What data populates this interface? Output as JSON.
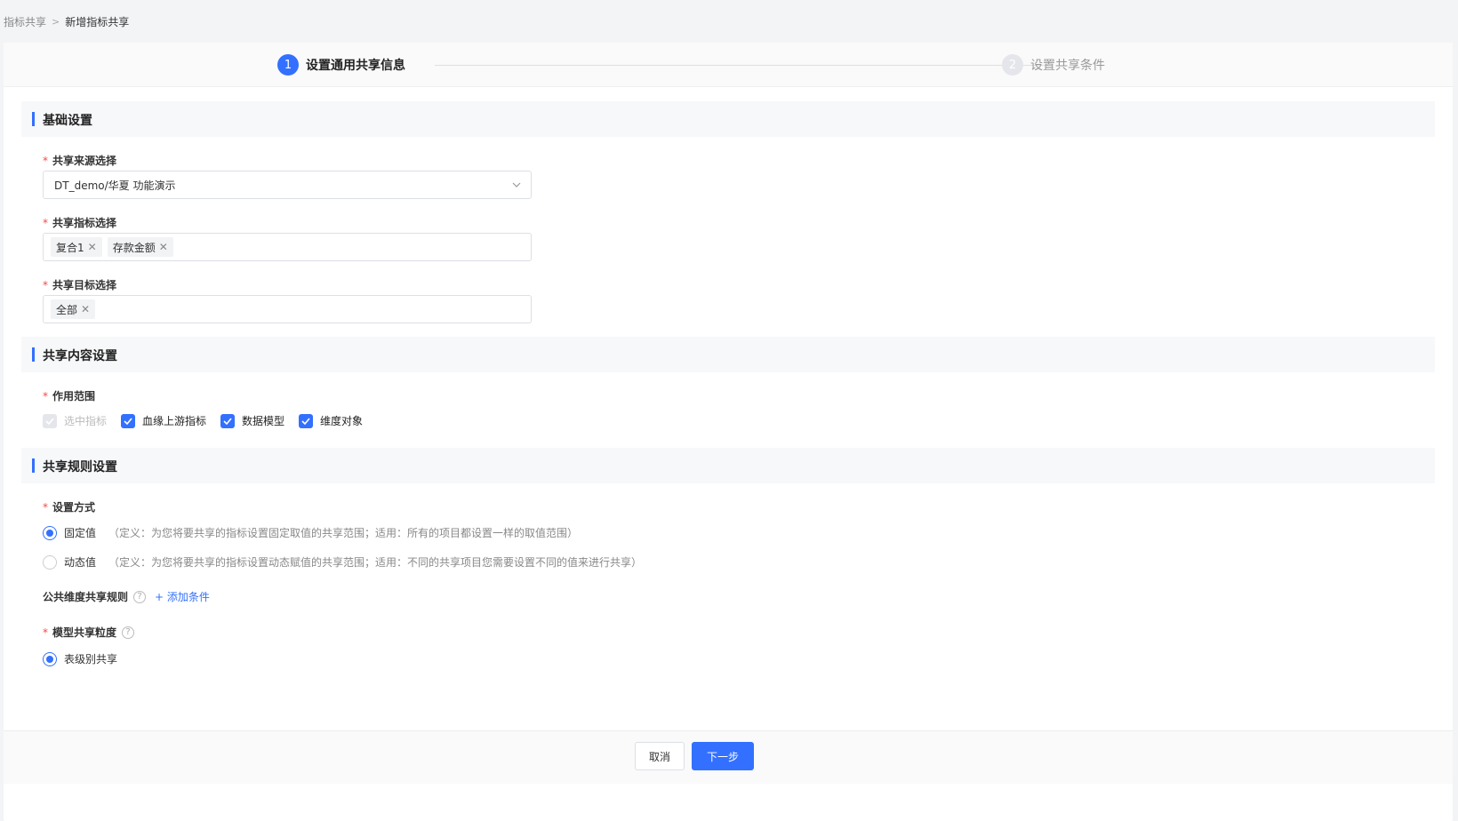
{
  "breadcrumb": {
    "parent": "指标共享",
    "separator": ">",
    "current": "新增指标共享"
  },
  "steps": [
    {
      "num": "1",
      "label": "设置通用共享信息"
    },
    {
      "num": "2",
      "label": "设置共享条件"
    }
  ],
  "sections": {
    "basic": "基础设置",
    "content": "共享内容设置",
    "rules": "共享规则设置"
  },
  "source": {
    "label": "共享来源选择",
    "value": "DT_demo/华夏 功能演示"
  },
  "metrics": {
    "label": "共享指标选择",
    "tags": [
      "复合1",
      "存款金额"
    ]
  },
  "targets": {
    "label": "共享目标选择",
    "tags": [
      "全部"
    ]
  },
  "scope": {
    "label": "作用范围",
    "options": [
      "选中指标",
      "血缘上游指标",
      "数据模型",
      "维度对象"
    ]
  },
  "method": {
    "label": "设置方式",
    "fixed": {
      "label": "固定值",
      "desc": "（定义：为您将要共享的指标设置固定取值的共享范围；适用：所有的项目都设置一样的取值范围）"
    },
    "dynamic": {
      "label": "动态值",
      "desc": "（定义：为您将要共享的指标设置动态赋值的共享范围；适用：不同的共享项目您需要设置不同的值来进行共享）"
    }
  },
  "public_rule": {
    "label": "公共维度共享规则",
    "help": "?",
    "add": "+ 添加条件"
  },
  "granularity": {
    "label": "模型共享粒度",
    "help": "?",
    "option": "表级别共享"
  },
  "footer": {
    "cancel": "取消",
    "next": "下一步"
  }
}
